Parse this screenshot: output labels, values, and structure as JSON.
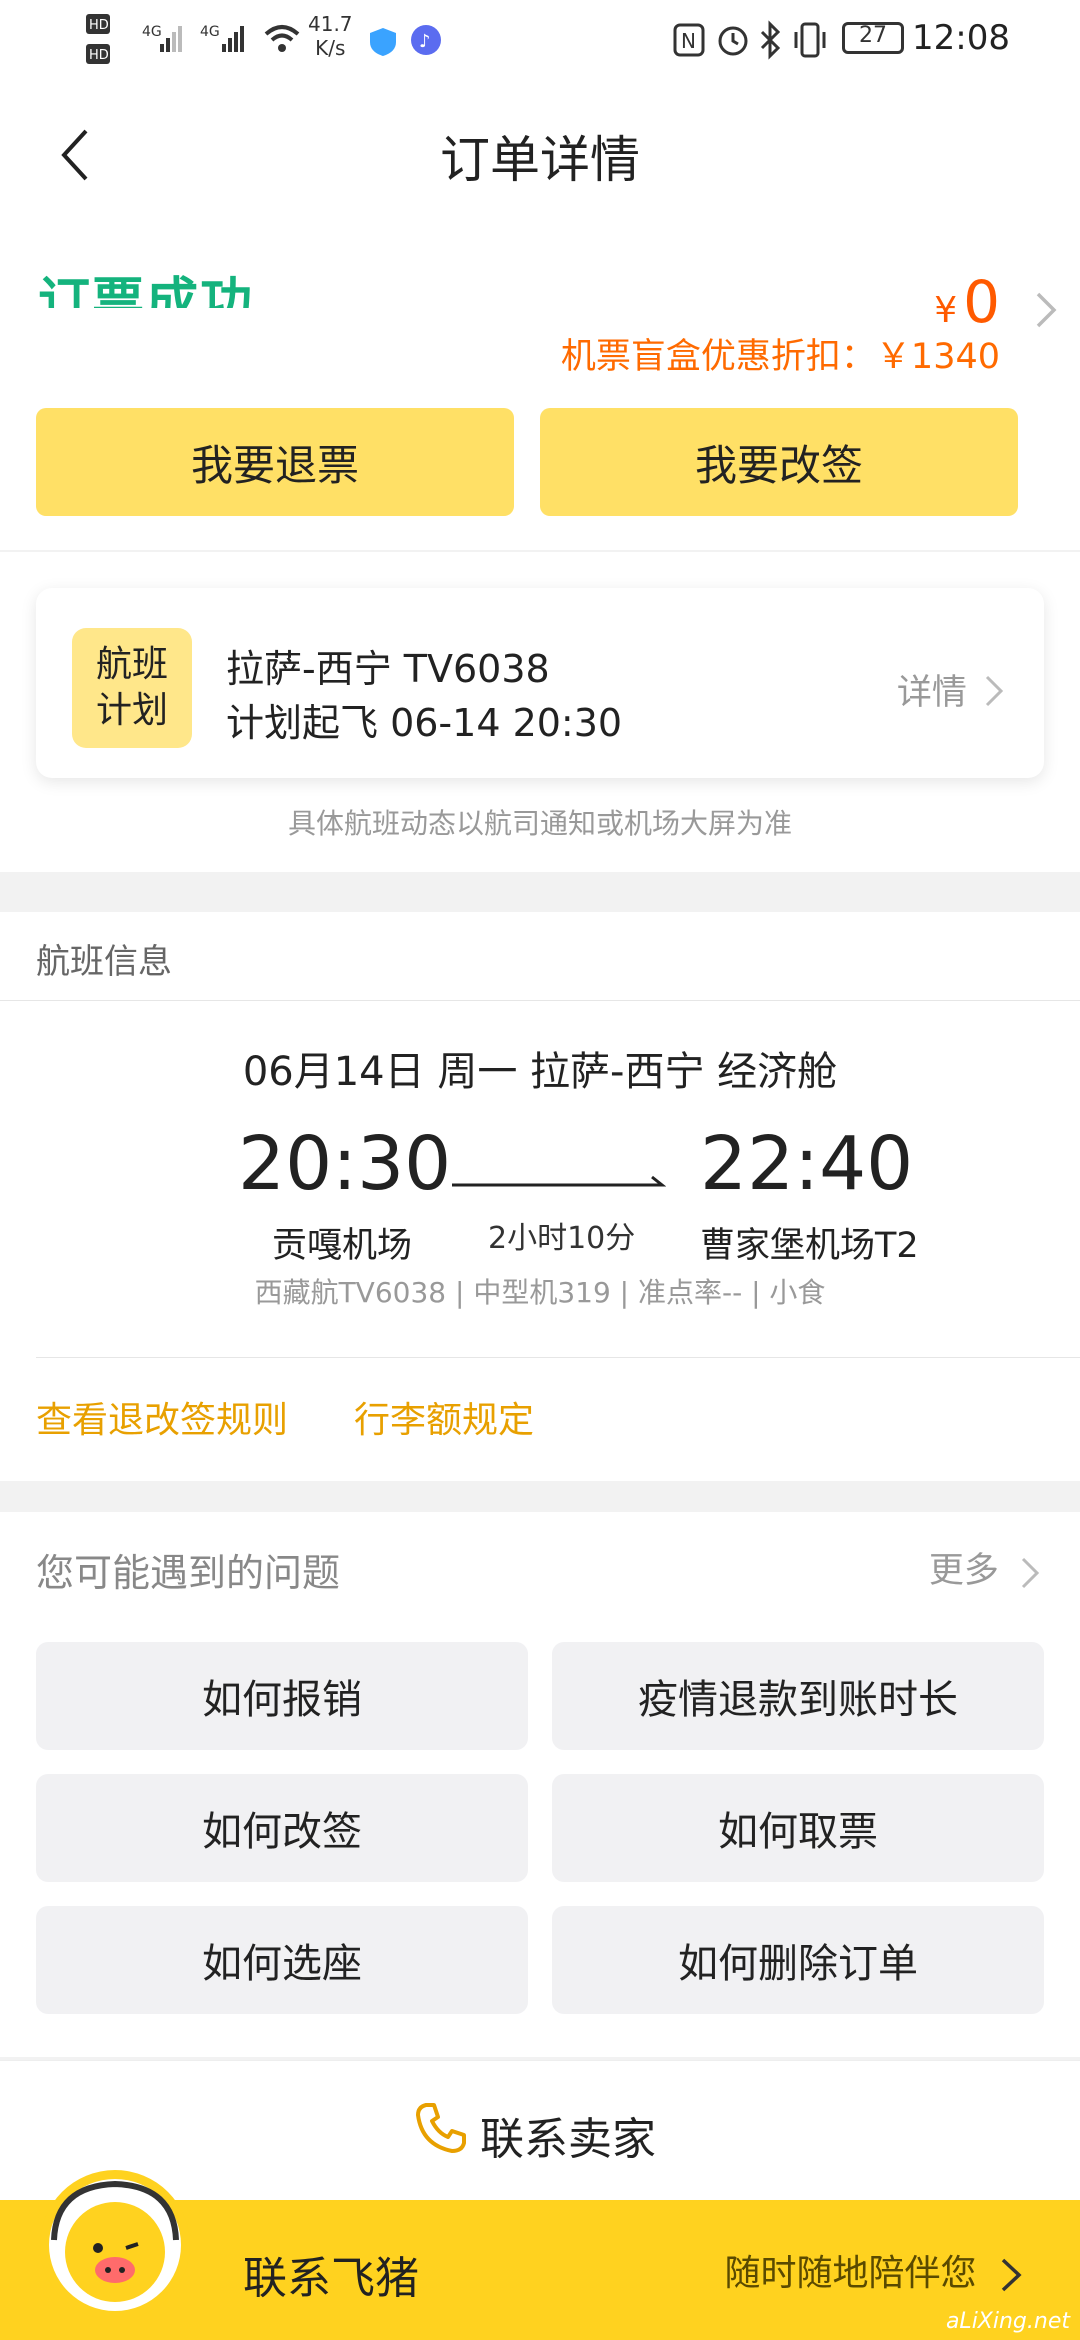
{
  "status_bar": {
    "net_speed_value": "41.7",
    "net_speed_unit": "K/s",
    "battery": "27",
    "time": "12:08"
  },
  "header": {
    "title": "订单详情"
  },
  "order": {
    "status": "订票成功",
    "price_symbol": "¥",
    "price": "0",
    "discount_label": "机票盲盒优惠折扣：￥1340",
    "refund_button": "我要退票",
    "change_button": "我要改签"
  },
  "plan": {
    "badge_line1": "航班",
    "badge_line2": "计划",
    "route": "拉萨-西宁 TV6038",
    "departure": "计划起飞 06-14 20:30",
    "detail": "详情",
    "note": "具体航班动态以航司通知或机场大屏为准"
  },
  "flight": {
    "section_title": "航班信息",
    "date": "06月14日 周一 拉萨-西宁 经济舱",
    "dep_time": "20:30",
    "arr_time": "22:40",
    "duration": "2小时10分",
    "dep_airport": "贡嘎机场",
    "arr_airport": "曹家堡机场T2",
    "meta": "西藏航TV6038 | 中型机319 | 准点率-- | 小食",
    "rules_link": "查看退改签规则",
    "baggage_link": "行李额规定"
  },
  "faq": {
    "title": "您可能遇到的问题",
    "more": "更多",
    "items": [
      "如何报销",
      "疫情退款到账时长",
      "如何改签",
      "如何取票",
      "如何选座",
      "如何删除订单"
    ]
  },
  "contact": {
    "label": "联系卖家"
  },
  "bottom": {
    "left": "联系飞猪",
    "right": "随时随地陪伴您",
    "watermark": "aLiXing.net"
  },
  "colors": {
    "accent_yellow": "#ffe066",
    "success_green": "#14b37d",
    "price_orange": "#ff5a00",
    "link_gold": "#e8a000",
    "bottom_bar": "#ffd21f"
  }
}
